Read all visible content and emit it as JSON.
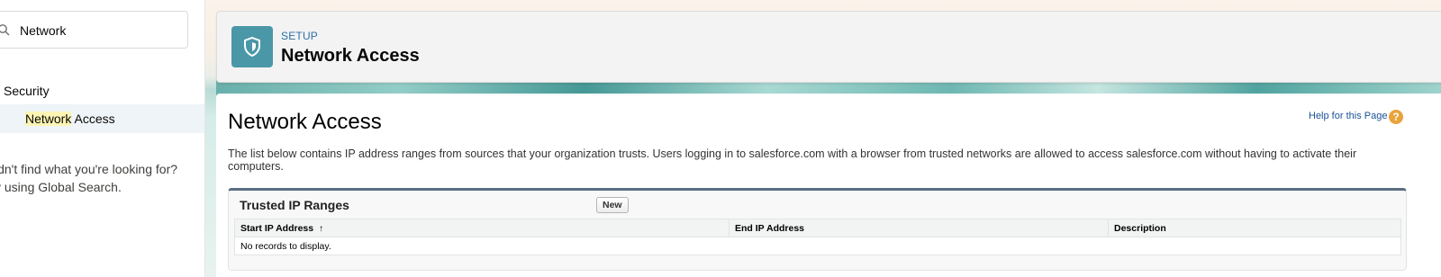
{
  "sidebar": {
    "search": {
      "value": "Network",
      "icon": "search-icon"
    },
    "tree": {
      "parent": "Security",
      "child_highlight": "Network",
      "child_rest": " Access"
    },
    "not_found": {
      "line1": "idn't find what you're looking for?",
      "line2": "y using Global Search."
    }
  },
  "header": {
    "eyebrow": "SETUP",
    "title": "Network Access",
    "icon": "shield-icon",
    "icon_bg": "#4a97a7"
  },
  "content": {
    "heading": "Network Access",
    "help_link": "Help for this Page",
    "help_icon": "?",
    "description": "The list below contains IP address ranges from sources that your organization trusts. Users logging in to salesforce.com with a browser from trusted networks are allowed to access salesforce.com without having to activate their computers."
  },
  "trusted_ranges": {
    "title": "Trusted IP Ranges",
    "new_button": "New",
    "columns": [
      "Start IP Address",
      "End IP Address",
      "Description"
    ],
    "sort_indicator": "↑",
    "empty_message": "No records to display."
  },
  "colors": {
    "link": "#1b5297",
    "setup_label": "#2b6fa8",
    "help_icon": "#e8a33b",
    "highlight": "#fdf5b3",
    "selected_row": "#eef4f8"
  }
}
